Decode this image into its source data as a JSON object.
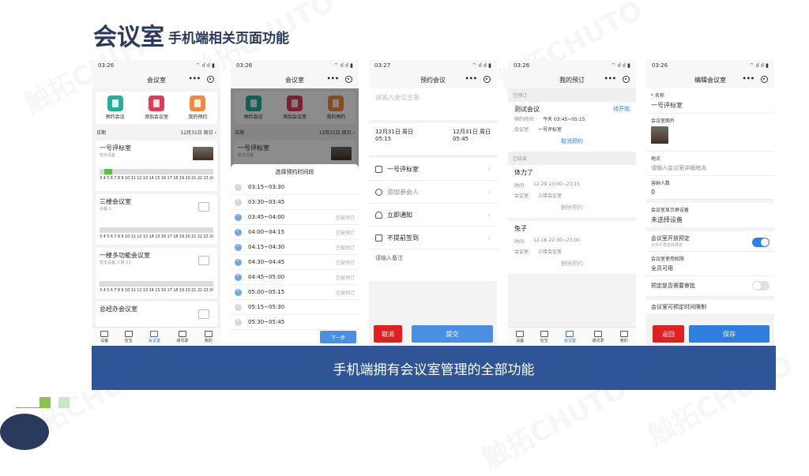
{
  "header": {
    "title_main": "会议室",
    "title_sub": "手机端相关页面功能"
  },
  "banner": {
    "text": "手机端拥有会议室管理的全部功能"
  },
  "watermark": "CHUTO",
  "watermark_cn": "触拓",
  "colors": {
    "primary": "#2f5597",
    "title": "#2a3a5c",
    "accent_blue": "#4a90e2",
    "danger": "#e02020",
    "green": "#8bc34a"
  },
  "screen1": {
    "time": "03:26",
    "signal": "⌔ ıl ıl ▮",
    "title": "会议室",
    "actions": [
      {
        "label": "预约会议",
        "color": "#22b09a"
      },
      {
        "label": "添加会议室",
        "color": "#e23b5a"
      },
      {
        "label": "我的预约",
        "color": "#ef8a3e"
      }
    ],
    "date_label": "日期",
    "date_value": "12月31日 周日",
    "rooms": [
      {
        "name": "一号评标室",
        "sub": "暂无设备",
        "hours": "3 4 5 6 7 8 9 10 11 12 13 14 15 16 17 18 19 20 21 22 23 24"
      },
      {
        "name": "三楼会议室",
        "sub": "设备:1",
        "hours": "3 4 5 6 7 8 9 10 11 12 13 14 15 16 17 18 19 20 21 22 23 24"
      },
      {
        "name": "一楼多功能会议室",
        "sub": "暂无设备    人数:11",
        "hours": "3 4 5 6 7 8 9 10 11 12 13 14 15 16 17 18 19 20 21 22 23 24"
      },
      {
        "name": "总经办会议室",
        "sub": ""
      }
    ],
    "tabs": [
      "设备",
      "信宝",
      "会议室",
      "通讯录",
      "我的"
    ]
  },
  "screen2": {
    "time": "03:26",
    "title": "会议室",
    "sheet_title": "选择预约时间段",
    "slots": [
      {
        "time": "03:15~03:30",
        "status": ""
      },
      {
        "time": "03:30~03:45",
        "status": ""
      },
      {
        "time": "03:45~04:00",
        "status": "已被预订"
      },
      {
        "time": "04:00~04:15",
        "status": "已被预订"
      },
      {
        "time": "04:15~04:30",
        "status": "已被预订"
      },
      {
        "time": "04:30~04:45",
        "status": "已被预订"
      },
      {
        "time": "04:45~05:00",
        "status": "已被预订"
      },
      {
        "time": "05:00~05:15",
        "status": "已被预订"
      },
      {
        "time": "05:15~05:30",
        "status": ""
      },
      {
        "time": "05:30~05:45",
        "status": ""
      }
    ],
    "next_label": "下一步"
  },
  "screen3": {
    "time": "03:27",
    "title": "预约会议",
    "subject_placeholder": "请输入会议主题",
    "start": {
      "date": "12月31日 周日",
      "time": "05:15"
    },
    "end": {
      "date": "12月31日 周日",
      "time": "05:45"
    },
    "room": "一号评标室",
    "add_participants": "添加参会人",
    "notify": "立即通知",
    "checkin": "不提前签到",
    "remark_placeholder": "请输入备注",
    "cancel": "取消",
    "submit": "提交"
  },
  "screen4": {
    "time": "03:26",
    "title": "我的预订",
    "section_booked": "已预订",
    "section_done": "已结束",
    "meetings": [
      {
        "name": "测试会议",
        "status": "待开始",
        "time_label": "预约时间:",
        "time": "今天 03:45~05:15",
        "room_label": "会议室:",
        "room": "一号评标室",
        "action": "取消预约"
      },
      {
        "name": "体力了",
        "time_label": "时间:",
        "time": "12-29 23:00~23:15",
        "room_label": "会议室:",
        "room": "三楼会议室",
        "action": "删除预约"
      },
      {
        "name": "兔子",
        "time_label": "时间:",
        "time": "12-16 22:30~23:00",
        "room_label": "会议室:",
        "room": "三楼会议室",
        "action": "删除预约"
      }
    ],
    "tabs": [
      "设备",
      "信宝",
      "会议室",
      "通讯录",
      "我的"
    ]
  },
  "screen5": {
    "time": "03:26",
    "title": "编辑会议室",
    "name_label": "* 名称",
    "name_value": "一号评标室",
    "image_label": "会议室图片",
    "location_label": "地点",
    "location_placeholder": "请输入会议室详细地点",
    "capacity_label": "容纳人数",
    "capacity_value": "0",
    "screen_label": "会议室显示屏设备",
    "screen_value": "未选择设备",
    "open_label": "会议室开放预定",
    "open_sub": "允许人员在线预定",
    "rule_label": "会议室使用权限",
    "rule_value": "全员可用",
    "approve_label": "预定是否需要审批",
    "limit_label": "会议室可预定时间限制",
    "back": "返回",
    "save": "保存"
  }
}
